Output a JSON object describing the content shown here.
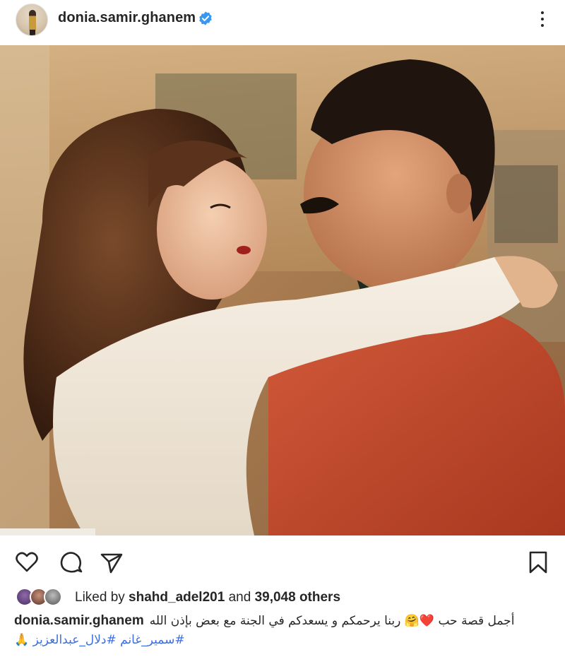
{
  "post": {
    "username": "donia.samir.ghanem",
    "verified": true,
    "menu_icon": "more-vertical-icon",
    "image_alt": "vintage photo of an embracing couple"
  },
  "actions": {
    "like_icon": "heart-icon",
    "comment_icon": "comment-icon",
    "share_icon": "send-icon",
    "save_icon": "bookmark-icon"
  },
  "likes": {
    "prefix": "Liked by ",
    "user": "shahd_adel201",
    "middle": " and ",
    "count": "39,048 others"
  },
  "caption": {
    "username": "donia.samir.ghanem",
    "text": "أجمل قصة حب ❤️🤗 ربنا يرحمكم و يسعدكم في الجنة مع بعض بإذن الله",
    "hashtags": "#سمير_غانم #دلال_عبدالعزيز",
    "emoji": "🙏"
  },
  "colors": {
    "text": "#262626",
    "hashtag": "#3d6ee0",
    "verified": "#3897f0"
  }
}
